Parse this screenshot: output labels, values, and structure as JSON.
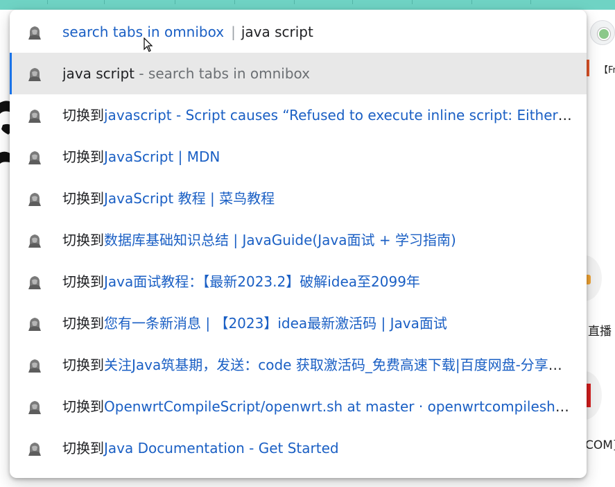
{
  "background": {
    "partial_tab_text": "【Fr",
    "live_label_fragment": "直播",
    "com_fragment": "COM]"
  },
  "omnibox": {
    "keyword_mode": "search tabs in omnibox",
    "separator": "|",
    "query": "java script",
    "default_suggestion": {
      "text": "java script",
      "hint": " - search tabs in omnibox"
    },
    "switch_prefix": "切换到",
    "suggestions": [
      {
        "title": "javascript - Script causes “Refused to execute inline script: Either the 'unsafe-inline' keyword, a hash"
      },
      {
        "title": "JavaScript | MDN"
      },
      {
        "title": "JavaScript 教程 | 菜鸟教程"
      },
      {
        "title": "数据库基础知识总结 | JavaGuide(Java面试 + 学习指南)"
      },
      {
        "title": "Java面试教程：【最新2023.2】破解idea至2099年"
      },
      {
        "title": "您有一条新消息 | 【2023】idea最新激活码 | Java面试"
      },
      {
        "title": "关注Java筑基期，发送：code 获取激活码_免费高速下载|百度网盘-分享无限制"
      },
      {
        "title": "OpenwrtCompileScript/openwrt.sh at master · openwrtcompileshell/OpenwrtCompileScript"
      },
      {
        "title": "Java Documentation - Get Started"
      }
    ]
  },
  "colors": {
    "accent": "#1a73e8",
    "link": "#1a5fc4",
    "selected_bg": "#e8e8e8",
    "topbar": "#6fd3c4"
  }
}
